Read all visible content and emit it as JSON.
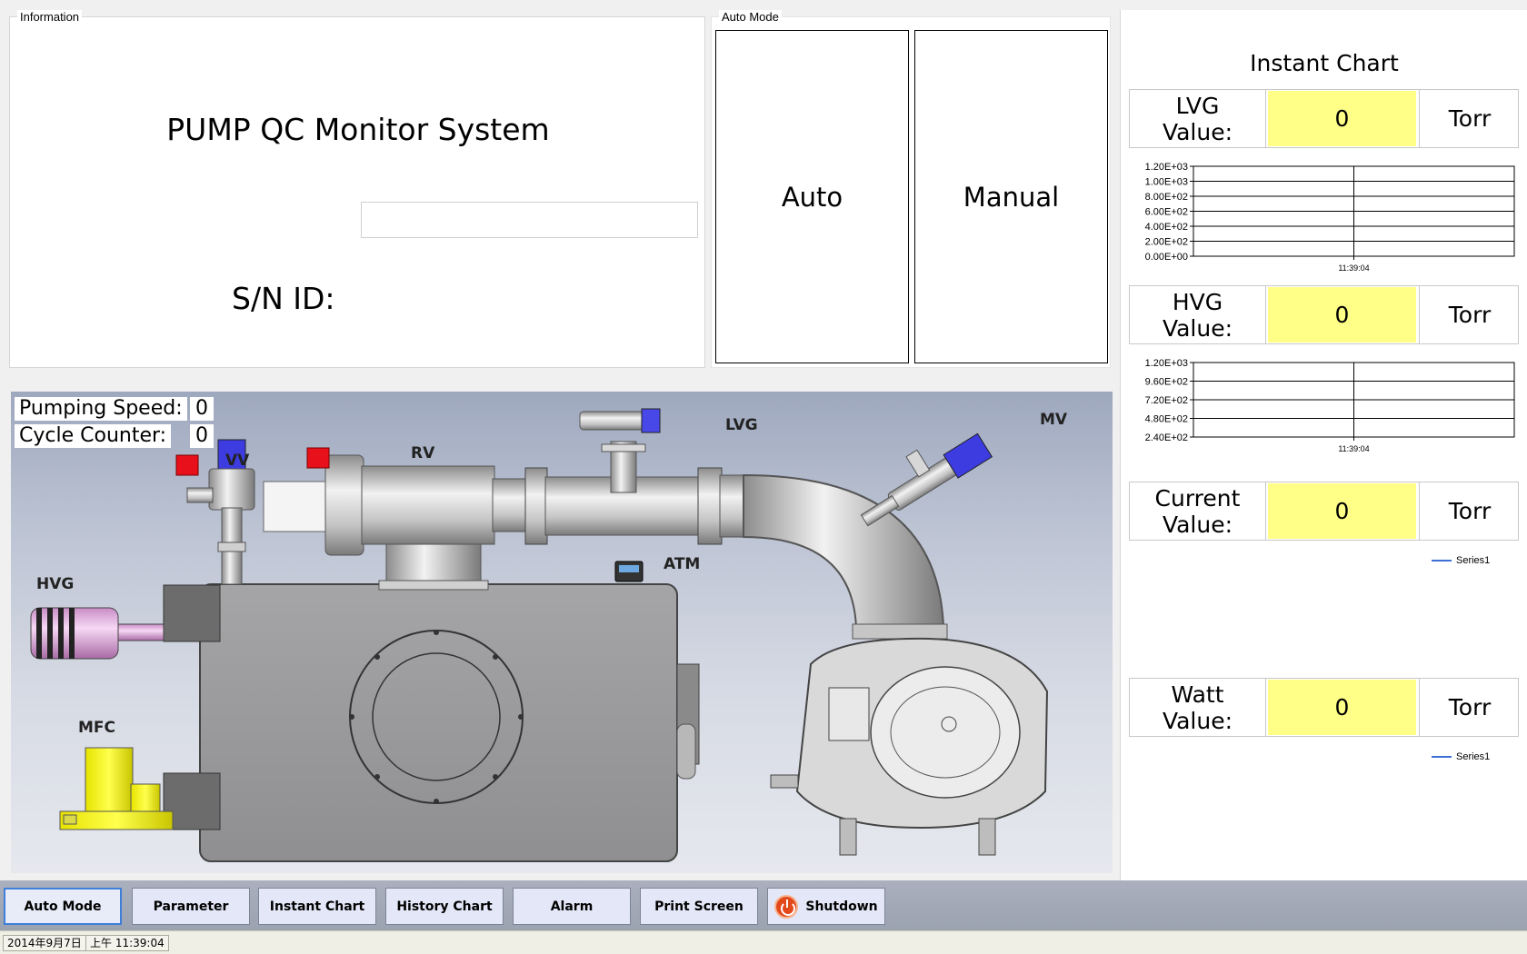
{
  "info": {
    "legend": "Information",
    "title": "PUMP QC Monitor System",
    "sn_label": "S/N ID:",
    "sn_value": ""
  },
  "auto_mode": {
    "legend": "Auto Mode",
    "auto_label": "Auto",
    "manual_label": "Manual"
  },
  "diagram": {
    "pumping_speed_label": "Pumping Speed:",
    "pumping_speed_value": "0",
    "cycle_counter_label": "Cycle Counter:",
    "cycle_counter_value": "0",
    "labels": {
      "vv": "VV",
      "rv": "RV",
      "lvg": "LVG",
      "mv": "MV",
      "atm": "ATM",
      "hvg": "HVG",
      "mfc": "MFC"
    },
    "colors": {
      "valve_indicator": "#e8101a",
      "valve_blue": "#3333dd"
    }
  },
  "instant_chart": {
    "title": "Instant Chart",
    "rows": [
      {
        "label": "LVG\nValue:",
        "value": "0",
        "unit": "Torr"
      },
      {
        "label": "HVG\nValue:",
        "value": "0",
        "unit": "Torr"
      },
      {
        "label": "Current\nValue:",
        "value": "0",
        "unit": "Torr"
      },
      {
        "label": "Watt\nValue:",
        "value": "0",
        "unit": "Torr"
      }
    ],
    "legend_series": "Series1",
    "highlight_color": "#ffff88"
  },
  "chart_data": [
    {
      "type": "line",
      "y_ticks": [
        "1.20E+03",
        "1.00E+03",
        "8.00E+02",
        "6.00E+02",
        "4.00E+02",
        "2.00E+02",
        "0.00E+00"
      ],
      "x_ticks": [
        "11:39:04"
      ],
      "ylim": [
        0,
        1200
      ],
      "grid": true,
      "series": []
    },
    {
      "type": "line",
      "y_ticks": [
        "1.20E+03",
        "9.60E+02",
        "7.20E+02",
        "4.80E+02",
        "2.40E+02"
      ],
      "x_ticks": [
        "11:39:04"
      ],
      "ylim": [
        0,
        1200
      ],
      "grid": true,
      "series": []
    },
    {
      "type": "line",
      "series": [
        {
          "name": "Series1",
          "values": []
        }
      ],
      "legend": "top-right"
    },
    {
      "type": "line",
      "series": [
        {
          "name": "Series1",
          "values": []
        }
      ],
      "legend": "top-right"
    }
  ],
  "toolbar": {
    "buttons": [
      "Auto Mode",
      "Parameter",
      "Instant Chart",
      "History Chart",
      "Alarm",
      "Print Screen",
      "Shutdown"
    ]
  },
  "status": {
    "date": "2014年9月7日",
    "time": "上午 11:39:04"
  }
}
